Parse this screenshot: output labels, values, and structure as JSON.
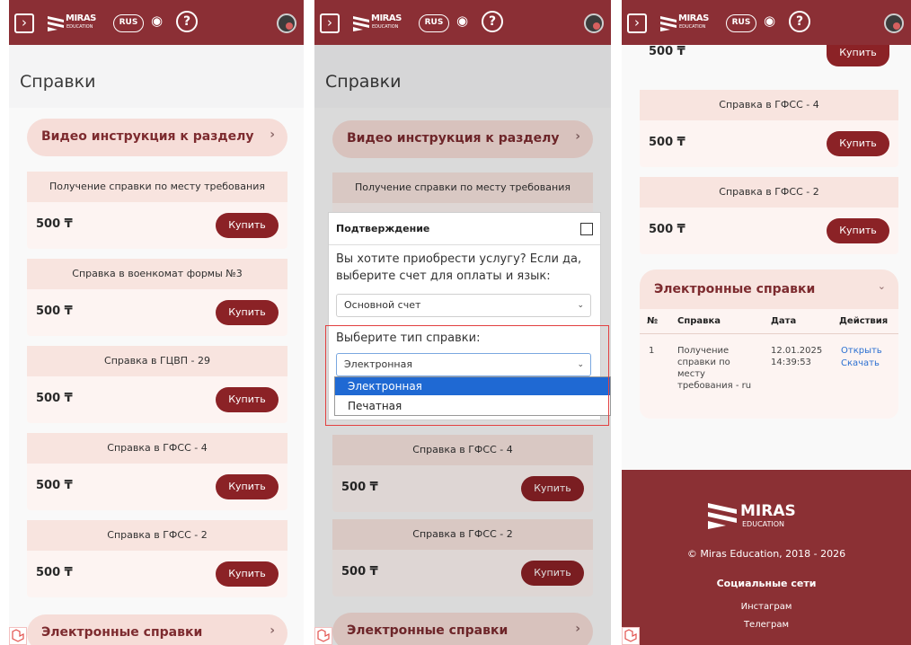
{
  "header": {
    "menu_glyph": "›",
    "logo_word": "MIRAS",
    "logo_sub": "EDUCATION",
    "lang": "RUS",
    "help": "?"
  },
  "page": {
    "title": "Справки"
  },
  "sections": {
    "video": "Видео инструкция к разделу",
    "electronic": "Электронные справки"
  },
  "cards": [
    {
      "title": "Получение справки по месту требования",
      "price": "500 ₸",
      "buy": "Купить"
    },
    {
      "title": "Справка в военкомат формы №3",
      "price": "500 ₸",
      "buy": "Купить"
    },
    {
      "title": "Справка в ГЦВП - 29",
      "price": "500 ₸",
      "buy": "Купить"
    },
    {
      "title": "Справка в ГФСС - 4",
      "price": "500 ₸",
      "buy": "Купить"
    },
    {
      "title": "Справка в ГФСС - 2",
      "price": "500 ₸",
      "buy": "Купить"
    }
  ],
  "dialog": {
    "title": "Подтверждение",
    "question": "Вы хотите приобрести услугу? Если да, выберите счет для оплаты и язык:",
    "account": "Основной счет",
    "type_label": "Выберите тип справки:",
    "type_value": "Электронная",
    "options": [
      "Электронная",
      "Печатная"
    ]
  },
  "scrolled_top": {
    "price": "500 ₸",
    "buy": "Купить"
  },
  "table": {
    "columns": [
      "№",
      "Справка",
      "Дата",
      "Действия"
    ],
    "rows": [
      {
        "num": "1",
        "name": "Получение справки по месту требования - ru",
        "date": "12.01.2025 14:39:53",
        "open": "Открыть",
        "download": "Скачать"
      }
    ]
  },
  "footer": {
    "logo_word": "MIRAS",
    "logo_sub": "EDUCATION",
    "copyright": "© Miras Education, 2018 - 2026",
    "social_title": "Социальные сети",
    "links": [
      "Инстаграм",
      "Телеграм"
    ]
  },
  "colors": {
    "brand": "#8b2f35",
    "button": "#8b2226",
    "card_header": "#f8e4df",
    "select_highlight": "#1f69d3"
  }
}
